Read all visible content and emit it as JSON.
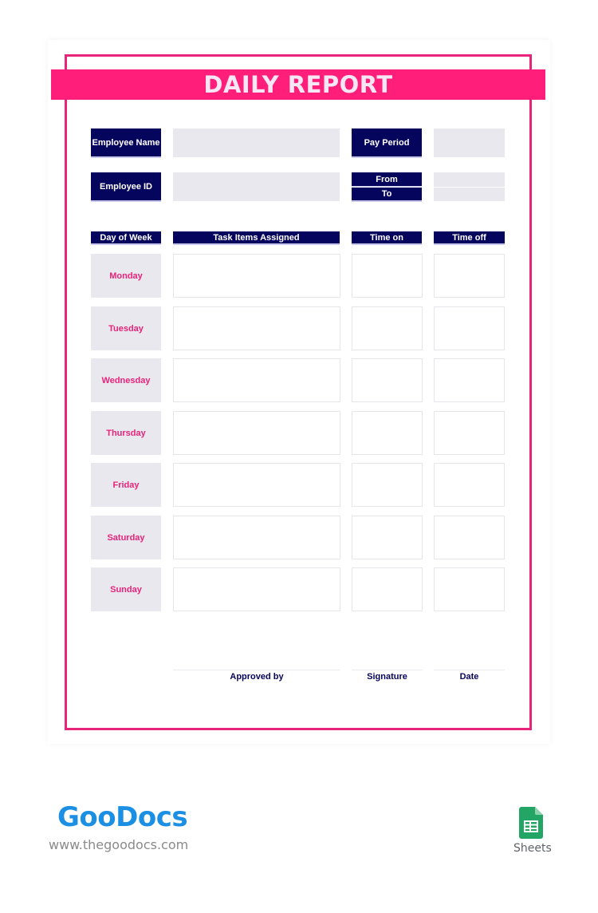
{
  "document": {
    "title": "DAILY REPORT",
    "colors": {
      "accent": "#ff1f7a",
      "navy": "#06055e",
      "field": "#e9e8ef"
    }
  },
  "info": {
    "employee_name_label": "Employee Name",
    "employee_name_value": "",
    "employee_id_label": "Employee ID",
    "employee_id_value": "",
    "pay_period_label": "Pay Period",
    "pay_period_value": "",
    "from_label": "From",
    "from_value": "",
    "to_label": "To",
    "to_value": ""
  },
  "table": {
    "headers": [
      "Day of Week",
      "Task Items Assigned",
      "Time on",
      "Time off"
    ],
    "rows": [
      {
        "day": "Monday",
        "tasks": "",
        "time_on": "",
        "time_off": ""
      },
      {
        "day": "Tuesday",
        "tasks": "",
        "time_on": "",
        "time_off": ""
      },
      {
        "day": "Wednesday",
        "tasks": "",
        "time_on": "",
        "time_off": ""
      },
      {
        "day": "Thursday",
        "tasks": "",
        "time_on": "",
        "time_off": ""
      },
      {
        "day": "Friday",
        "tasks": "",
        "time_on": "",
        "time_off": ""
      },
      {
        "day": "Saturday",
        "tasks": "",
        "time_on": "",
        "time_off": ""
      },
      {
        "day": "Sunday",
        "tasks": "",
        "time_on": "",
        "time_off": ""
      }
    ]
  },
  "signatures": {
    "approved_by": "Approved by",
    "signature": "Signature",
    "date": "Date"
  },
  "branding": {
    "logo": "GooDocs",
    "url": "www.thegoodocs.com",
    "app_label": "Sheets",
    "app_icon": "google-sheets-icon"
  }
}
